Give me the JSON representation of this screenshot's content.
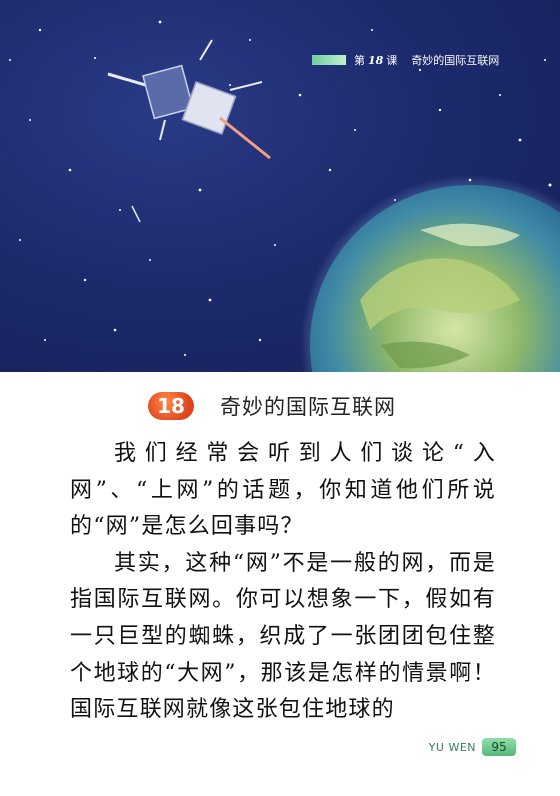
{
  "header": {
    "lesson_prefix": "第",
    "lesson_number": "18",
    "lesson_suffix": "课",
    "lesson_title": "奇妙的国际互联网"
  },
  "title": {
    "number": "18",
    "text": "奇妙的国际互联网"
  },
  "body": {
    "paragraphs": [
      "我们经常会听到人们谈论“入网”、“上网”的话题，你知道他们所说的“网”是怎么回事吗？",
      "其实，这种“网”不是一般的网，而是指国际互联网。你可以想象一下，假如有一只巨型的蜘蛛，织成了一张团团包住整个地球的“大网”，那该是怎样的情景啊！国际互联网就像这张包住地球的"
    ]
  },
  "footer": {
    "label": "YU WEN",
    "page_number": "95"
  },
  "colors": {
    "sky": "#1d2b6e",
    "badge": "#e0431c",
    "footer_green": "#55b97a"
  },
  "icons": {
    "satellite": "satellite-illustration",
    "earth": "earth-illustration"
  }
}
